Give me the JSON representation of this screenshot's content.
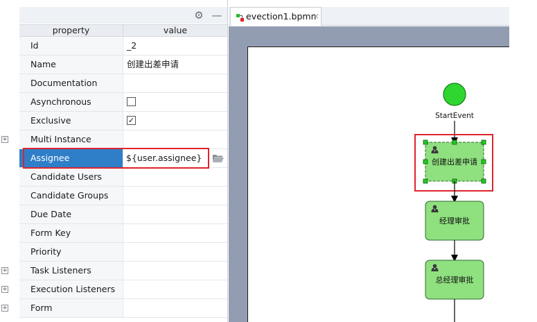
{
  "toolbar": {
    "settings_icon": "gear-icon",
    "minimize_icon": "minimize-icon"
  },
  "property_table": {
    "headers": {
      "property": "property",
      "value": "value"
    },
    "rows": [
      {
        "name": "Id",
        "value": "_2"
      },
      {
        "name": "Name",
        "value": "创建出差申请"
      },
      {
        "name": "Documentation",
        "value": ""
      },
      {
        "name": "Asynchronous",
        "value": "",
        "checked": false
      },
      {
        "name": "Exclusive",
        "value": "",
        "checked": true
      },
      {
        "name": "Multi Instance",
        "value": "",
        "expandable": true
      },
      {
        "name": "Assignee",
        "value": "${user.assignee}",
        "selected": true
      },
      {
        "name": "Candidate Users",
        "value": ""
      },
      {
        "name": "Candidate Groups",
        "value": ""
      },
      {
        "name": "Due Date",
        "value": ""
      },
      {
        "name": "Form Key",
        "value": ""
      },
      {
        "name": "Priority",
        "value": ""
      },
      {
        "name": "Task Listeners",
        "value": "",
        "expandable": true
      },
      {
        "name": "Execution Listeners",
        "value": "",
        "expandable": true
      },
      {
        "name": "Form",
        "value": "",
        "expandable": true
      }
    ],
    "expand_symbol": "+",
    "check_mark": "✓"
  },
  "editor": {
    "tab_title": "evection1.bpmn",
    "tab_close": "×"
  },
  "diagram": {
    "start_event_label": "StartEvent",
    "tasks": [
      {
        "label": "创建出差申请",
        "selected": true
      },
      {
        "label": "经理审批",
        "selected": false
      },
      {
        "label": "总经理审批",
        "selected": false
      }
    ],
    "colors": {
      "start_fill": "#2fd62f",
      "task_fill": "#8fe07f",
      "task_stroke": "#2b6b2b",
      "highlight": "#e0232b",
      "handle": "#22cc22",
      "canvas_bg": "#939db1"
    }
  }
}
